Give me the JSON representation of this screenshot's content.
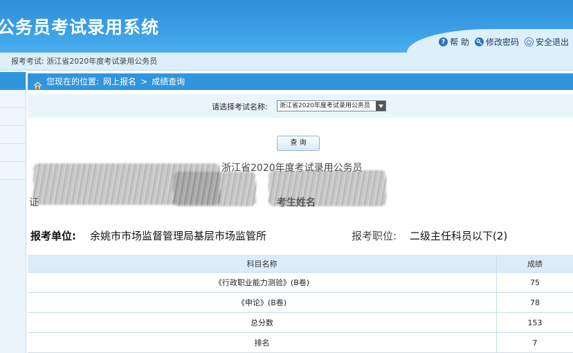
{
  "header": {
    "system_title": "公务员考试录用系统",
    "links": [
      {
        "label": "帮  助",
        "icon": "help-icon",
        "color": "#2f76b8"
      },
      {
        "label": "修改密码",
        "icon": "key-icon",
        "color": "#2f76b8"
      },
      {
        "label": "安全退出",
        "icon": "power-icon",
        "color": "#2f76b8"
      }
    ]
  },
  "exam_bar": {
    "label": "报考考试:",
    "value": "浙江省2020年度考试录用公务员"
  },
  "breadcrumb": {
    "prefix": "您现在的位置:",
    "items": [
      "网上报名",
      ">",
      "成绩查询"
    ]
  },
  "exam_select": {
    "label": "请选择考试名称:",
    "selected": "浙江省2020年度考试录用公务员"
  },
  "query_button": "查 询",
  "result": {
    "title": "浙江省2020年度考试录用公务员",
    "id_label_fragment": "证",
    "name_label": "考生姓名",
    "unit_label": "报考单位:",
    "unit_value": "余姚市市场监督管理局基层市场监管所",
    "position_label": "报考职位:",
    "position_value": "二级主任科员以下(2)"
  },
  "score_table": {
    "headers": [
      "科目名称",
      "成绩"
    ],
    "rows": [
      [
        "《行政职业能力测验》(B卷)",
        "75"
      ],
      [
        "《申论》(B卷)",
        "78"
      ],
      [
        "总分数",
        "153"
      ],
      [
        "排名",
        "7"
      ]
    ]
  },
  "colors": {
    "header_blue": "#3a9ee6",
    "breadcrumb_blue": "#2f96de",
    "light_panel": "#e9f4fb"
  }
}
